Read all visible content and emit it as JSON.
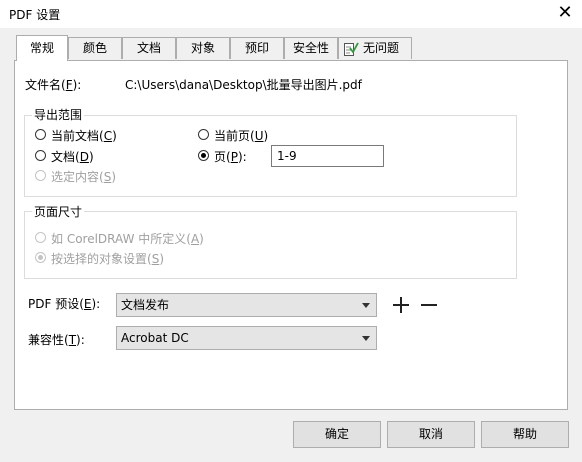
{
  "window": {
    "title": "PDF 设置",
    "close_icon": "close-icon"
  },
  "tabs": [
    {
      "label": "常规",
      "active": true
    },
    {
      "label": "颜色"
    },
    {
      "label": "文档"
    },
    {
      "label": "对象"
    },
    {
      "label": "预印"
    },
    {
      "label": "安全性"
    },
    {
      "label": "无问题",
      "icon": "check-document-icon"
    }
  ],
  "general": {
    "filename_label_pre": "文件名(",
    "filename_label_key": "F",
    "filename_label_post": "):",
    "filename_value": "C:\\Users\\dana\\Desktop\\批量导出图片.pdf",
    "export_range": {
      "legend": "导出范围",
      "current_doc": {
        "pre": "当前文档(",
        "key": "C",
        "post": ")",
        "checked": false
      },
      "documents": {
        "pre": "文档(",
        "key": "D",
        "post": ")",
        "checked": false
      },
      "selection": {
        "pre": "选定内容(",
        "key": "S",
        "post": ")",
        "checked": false,
        "disabled": true
      },
      "current_page": {
        "pre": "当前页(",
        "key": "U",
        "post": ")",
        "checked": false
      },
      "pages": {
        "pre": "页(",
        "key": "P",
        "post": "):",
        "checked": true
      },
      "pages_value": "1-9"
    },
    "page_size": {
      "legend": "页面尺寸",
      "as_defined": {
        "pre": "如 CorelDRAW 中所定义(",
        "key": "A",
        "post": ")",
        "checked": false,
        "disabled": true
      },
      "object_settings": {
        "pre": "按选择的对象设置(",
        "key": "S",
        "post": ")",
        "checked": true,
        "disabled": true
      }
    },
    "pdf_preset": {
      "label_pre": "PDF 预设(",
      "label_key": "E",
      "label_post": "):",
      "value": "文档发布",
      "add_icon": "plus-icon",
      "remove_icon": "minus-icon"
    },
    "compatibility": {
      "label_pre": "兼容性(",
      "label_key": "T",
      "label_post": "):",
      "value": "Acrobat DC"
    }
  },
  "buttons": {
    "ok": "确定",
    "cancel": "取消",
    "help": "帮助"
  }
}
